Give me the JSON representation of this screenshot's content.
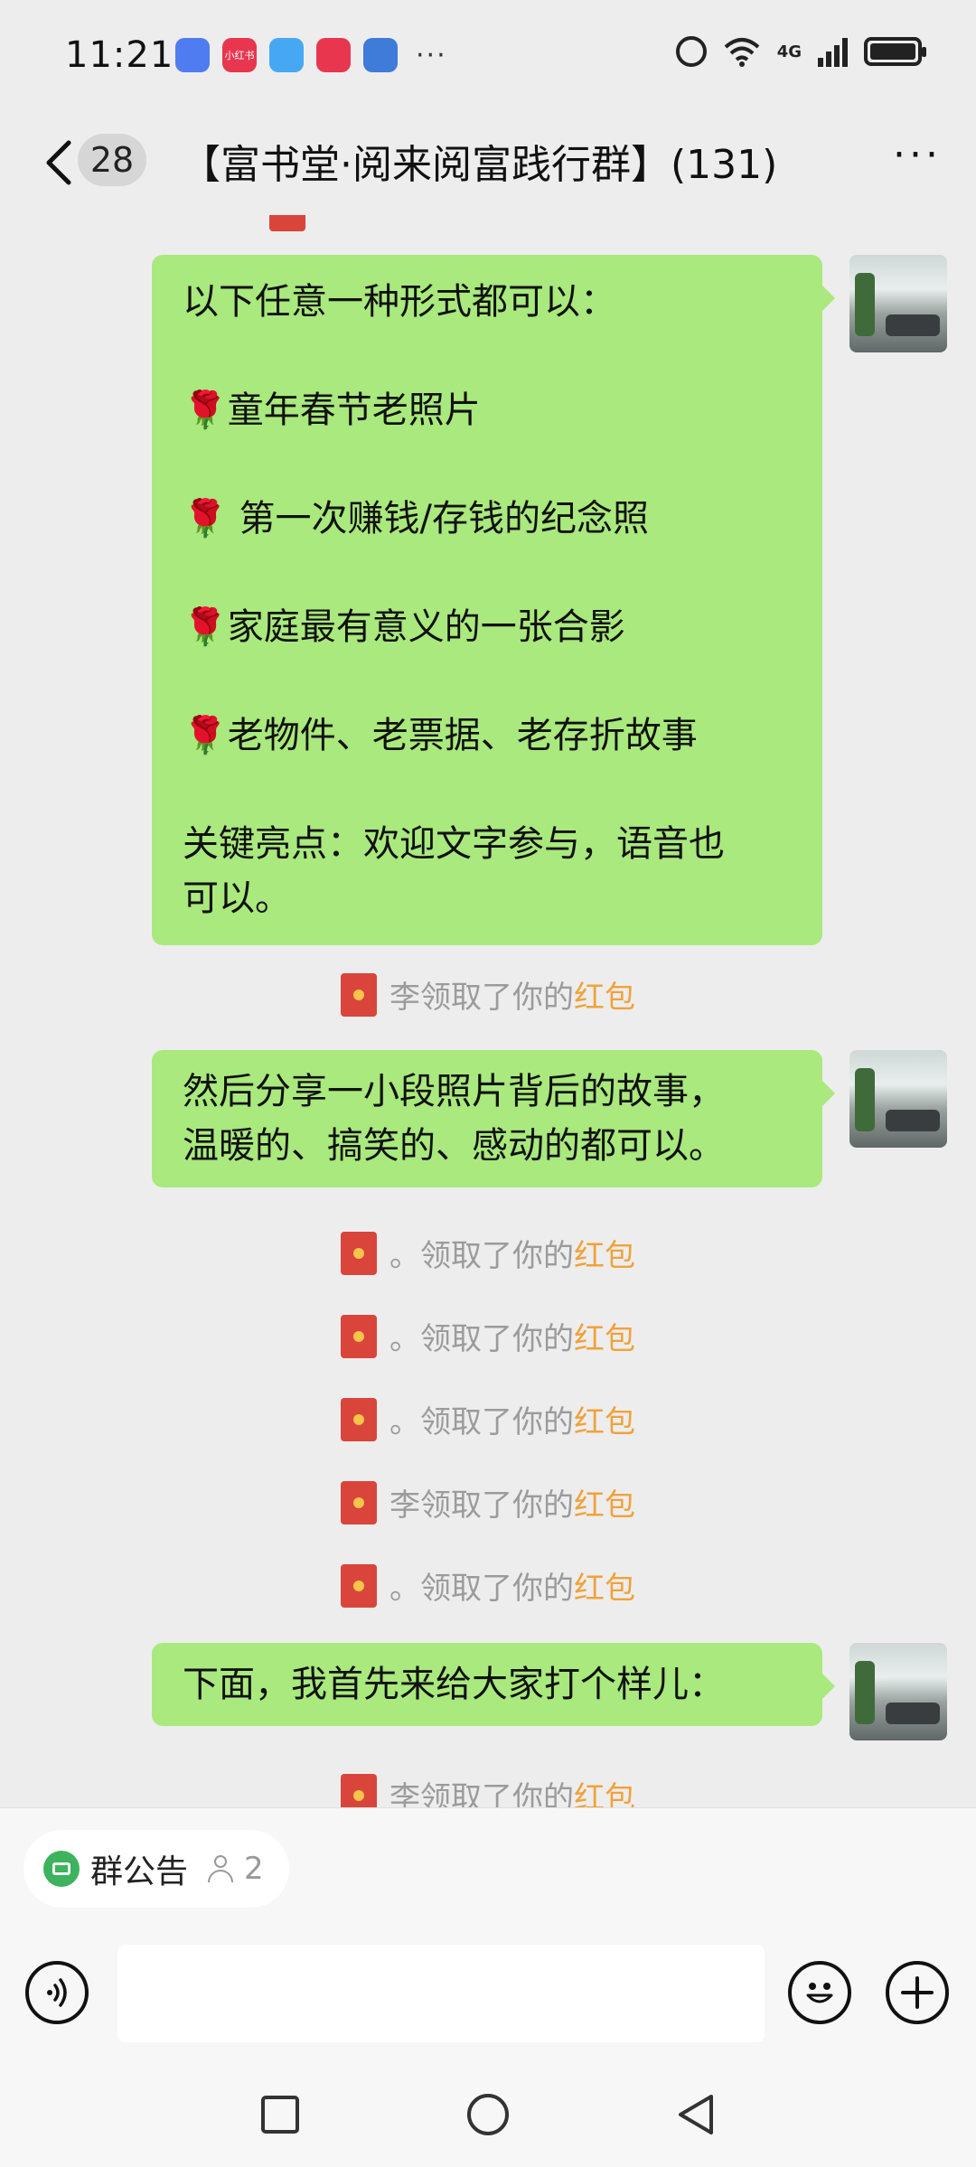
{
  "status_bar": {
    "time": "11:21",
    "network": "4G",
    "app_icons": [
      {
        "name": "compass-app-icon",
        "color": "#4f7cf0",
        "label": ""
      },
      {
        "name": "xiaohongshu-app-icon",
        "color": "#e8364f",
        "label": "小红书"
      },
      {
        "name": "weather-app-icon",
        "color": "#46a8f2",
        "label": ""
      },
      {
        "name": "health-app-icon",
        "color": "#e8364f",
        "label": ""
      },
      {
        "name": "files-app-icon",
        "color": "#3f7bd9",
        "label": ""
      }
    ],
    "more": "···"
  },
  "header": {
    "unread_count": "28",
    "title": "【富书堂·阅来阅富践行群】(131)",
    "menu": "···"
  },
  "messages": [
    {
      "lines": [
        "以下任意一种形式都可以：",
        "",
        "🌹童年春节老照片",
        "",
        "🌹 第一次赚钱/存钱的纪念照",
        "",
        "🌹家庭最有意义的一张合影",
        "",
        "🌹老物件、老票据、老存折故事",
        "",
        "关键亮点：欢迎文字参与，语音也",
        "可以。"
      ]
    },
    {
      "lines": [
        "然后分享一小段照片背后的故事，",
        "温暖的、搞笑的、感动的都可以。"
      ]
    },
    {
      "lines": [
        "下面，我首先来给大家打个样儿："
      ]
    }
  ],
  "system_messages": [
    {
      "who": "李",
      "text": "领取了你的",
      "link": "红包"
    },
    {
      "who": "。",
      "text": "领取了你的",
      "link": "红包"
    },
    {
      "who": "。",
      "text": "领取了你的",
      "link": "红包"
    },
    {
      "who": "。",
      "text": "领取了你的",
      "link": "红包"
    },
    {
      "who": "李",
      "text": "领取了你的",
      "link": "红包"
    },
    {
      "who": "。",
      "text": "领取了你的",
      "link": "红包"
    },
    {
      "who": "李",
      "text": "领取了你的",
      "link": "红包"
    }
  ],
  "notice": {
    "label": "群公告",
    "count": "2"
  },
  "input": {
    "placeholder": ""
  },
  "colors": {
    "bubble": "#a9e97d",
    "background": "#ededed",
    "highlight": "#f0a23a",
    "red_packet": "#d9453b"
  }
}
